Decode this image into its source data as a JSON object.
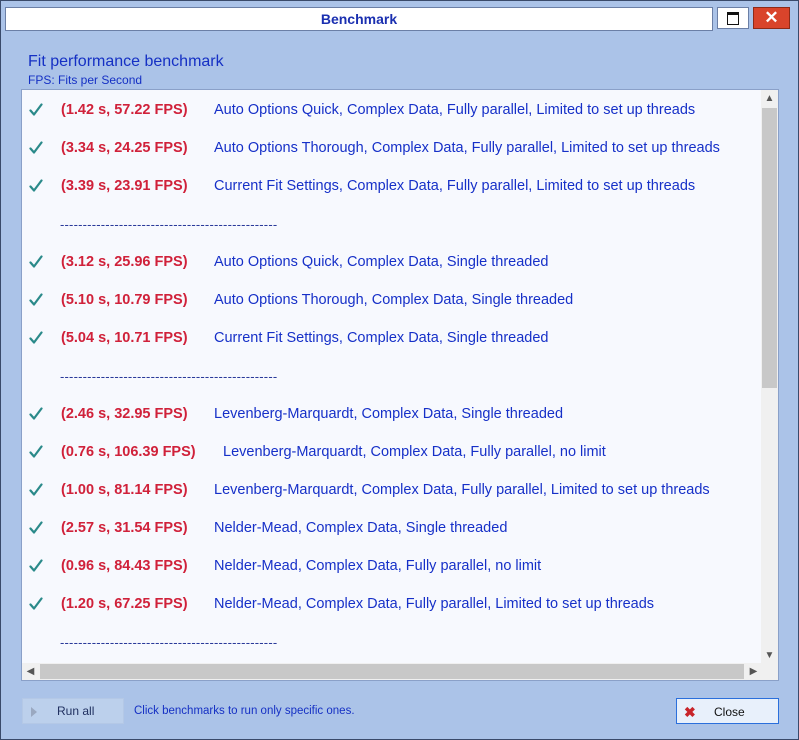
{
  "window": {
    "title": "Benchmark",
    "maximize_icon": "maximize-icon",
    "close_icon": "close-icon"
  },
  "heading": "Fit performance benchmark",
  "subheading": "FPS: Fits per Second",
  "separator": "------------------------------------------------",
  "rows": [
    {
      "type": "item",
      "time": "(1.42 s, 57.22 FPS)",
      "desc": "Auto Options Quick, Complex Data, Fully parallel, Limited to set up threads"
    },
    {
      "type": "item",
      "time": "(3.34 s, 24.25 FPS)",
      "desc": "Auto Options Thorough, Complex Data, Fully parallel, Limited to set up threads"
    },
    {
      "type": "item",
      "time": "(3.39 s, 23.91 FPS)",
      "desc": "Current Fit Settings, Complex Data, Fully parallel, Limited to set up threads"
    },
    {
      "type": "sep"
    },
    {
      "type": "item",
      "time": "(3.12 s, 25.96 FPS)",
      "desc": "Auto Options Quick, Complex Data, Single threaded"
    },
    {
      "type": "item",
      "time": "(5.10 s, 10.79 FPS)",
      "desc": "Auto Options Thorough, Complex Data, Single threaded"
    },
    {
      "type": "item",
      "time": "(5.04 s, 10.71 FPS)",
      "desc": "Current Fit Settings, Complex Data, Single threaded"
    },
    {
      "type": "sep"
    },
    {
      "type": "item",
      "time": "(2.46 s, 32.95 FPS)",
      "desc": "Levenberg-Marquardt, Complex Data, Single threaded"
    },
    {
      "type": "item",
      "time": "(0.76 s, 106.39 FPS)",
      "desc": "Levenberg-Marquardt, Complex Data, Fully parallel, no limit",
      "wide": true
    },
    {
      "type": "item",
      "time": "(1.00 s, 81.14 FPS)",
      "desc": "Levenberg-Marquardt, Complex Data, Fully parallel, Limited to set up threads"
    },
    {
      "type": "item",
      "time": "(2.57 s, 31.54 FPS)",
      "desc": "Nelder-Mead, Complex Data, Single threaded"
    },
    {
      "type": "item",
      "time": "(0.96 s, 84.43 FPS)",
      "desc": "Nelder-Mead, Complex Data, Fully parallel, no limit"
    },
    {
      "type": "item",
      "time": "(1.20 s, 67.25 FPS)",
      "desc": "Nelder-Mead, Complex Data, Fully parallel, Limited to set up threads"
    },
    {
      "type": "sep"
    }
  ],
  "footer": {
    "run_all_label": "Run all",
    "hint": "Click benchmarks to run only specific ones.",
    "close_label": "Close"
  },
  "colors": {
    "time": "#d0213a",
    "desc": "#1630c8",
    "check": "#2a8a8a"
  }
}
